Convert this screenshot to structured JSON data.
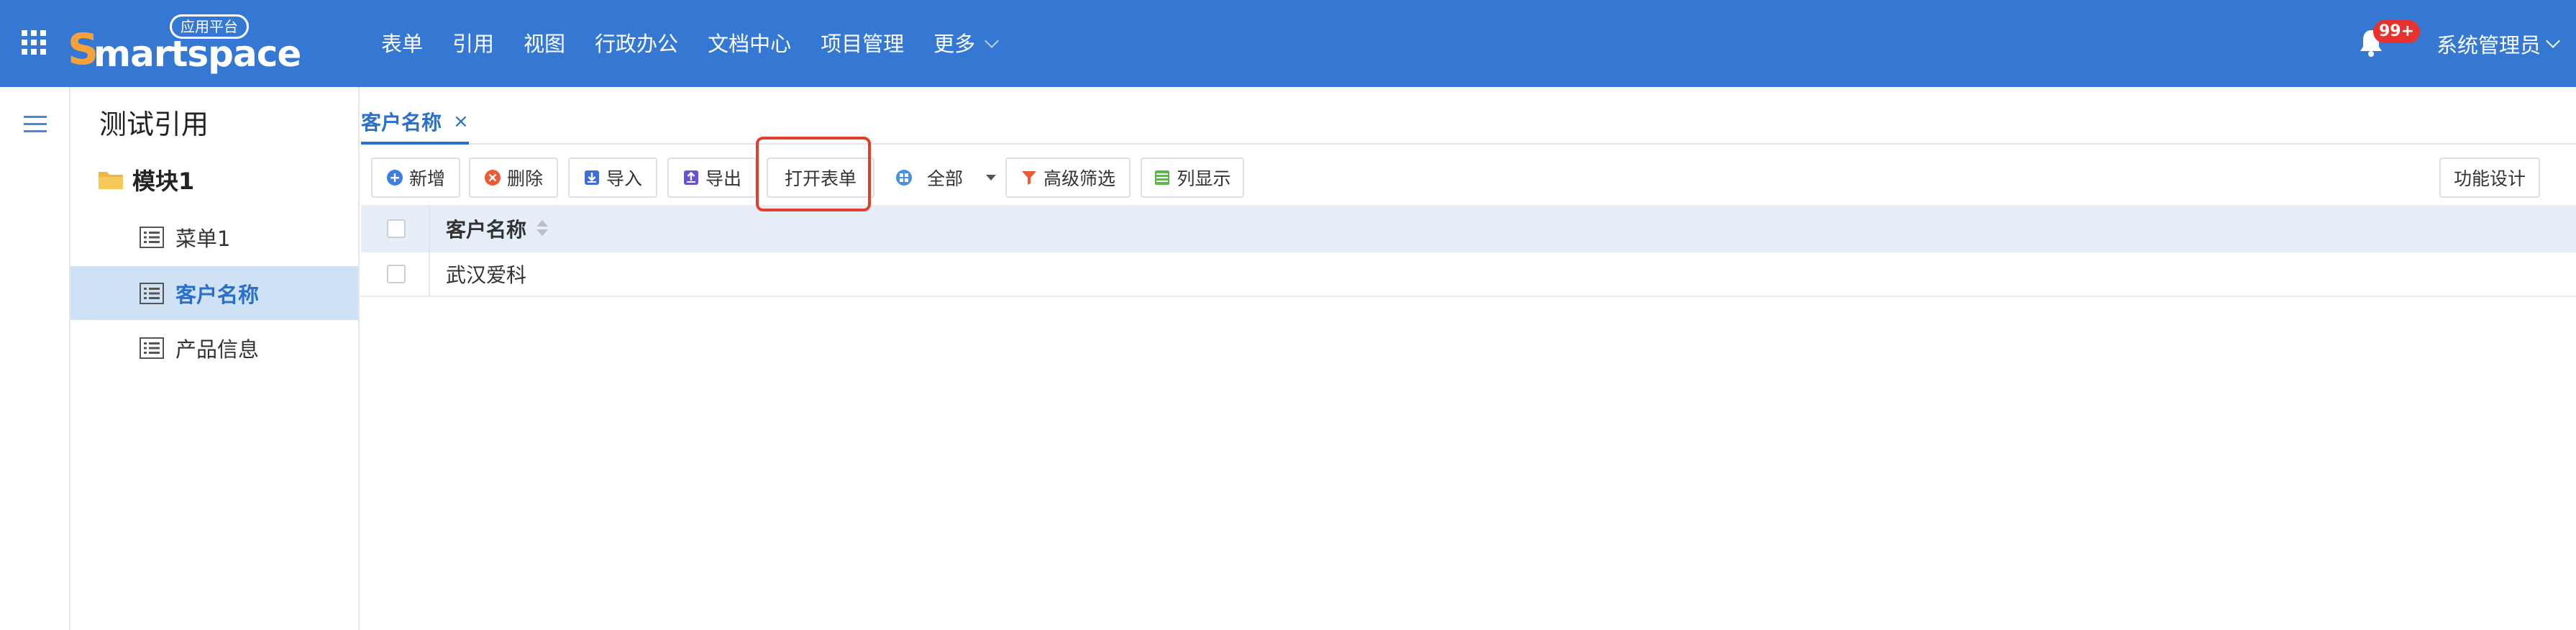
{
  "header": {
    "logo_text": "martspace",
    "logo_letter": "S",
    "logo_badge": "应用平台",
    "nav": [
      "表单",
      "引用",
      "视图",
      "行政办公",
      "文档中心",
      "项目管理",
      "更多"
    ],
    "notification_count": "99+",
    "user_name": "系统管理员"
  },
  "sidebar": {
    "title": "测试引用",
    "module": "模块1",
    "items": [
      {
        "label": "菜单1",
        "active": false
      },
      {
        "label": "客户名称",
        "active": true
      },
      {
        "label": "产品信息",
        "active": false
      }
    ]
  },
  "tabs": [
    {
      "label": "客户名称",
      "close": "×"
    }
  ],
  "toolbar": {
    "add": "新增",
    "delete": "删除",
    "import": "导入",
    "export": "导出",
    "open_form": "打开表单",
    "filter_all": "全部",
    "advanced_filter": "高级筛选",
    "column_display": "列显示",
    "function_design": "功能设计"
  },
  "table": {
    "columns": [
      "客户名称"
    ],
    "rows": [
      [
        "武汉爱科"
      ]
    ]
  },
  "colors": {
    "header_bg": "#3478d4",
    "accent": "#2a6fc9",
    "highlight_border": "#e0402f",
    "badge": "#e8322d"
  }
}
